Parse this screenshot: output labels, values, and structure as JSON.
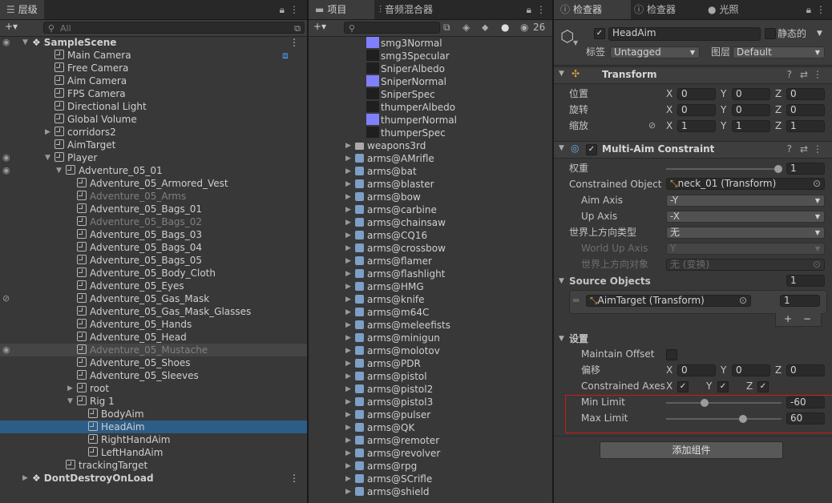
{
  "hierarchy": {
    "tab_label": "层级",
    "search_placeholder": "All",
    "add_label": "+▾",
    "rows": [
      {
        "label": "SampleScene",
        "indent": 0,
        "kind": "scene",
        "arrow": "down",
        "eye": true
      },
      {
        "label": "Main Camera",
        "indent": 2,
        "kind": "cube"
      },
      {
        "label": "Free Camera",
        "indent": 2,
        "kind": "cube"
      },
      {
        "label": "Aim Camera",
        "indent": 2,
        "kind": "cube"
      },
      {
        "label": "FPS Camera",
        "indent": 2,
        "kind": "cube"
      },
      {
        "label": "Directional Light",
        "indent": 2,
        "kind": "cube"
      },
      {
        "label": "Global Volume",
        "indent": 2,
        "kind": "cube"
      },
      {
        "label": "corridors2",
        "indent": 2,
        "kind": "cube",
        "arrow": "right"
      },
      {
        "label": "AimTarget",
        "indent": 2,
        "kind": "cube"
      },
      {
        "label": "Player",
        "indent": 2,
        "kind": "cube",
        "arrow": "down",
        "eye": true
      },
      {
        "label": "Adventure_05_01",
        "indent": 3,
        "kind": "cube",
        "arrow": "down",
        "eye": true
      },
      {
        "label": "Adventure_05_Armored_Vest",
        "indent": 4,
        "kind": "cube"
      },
      {
        "label": "Adventure_05_Arms",
        "indent": 4,
        "kind": "cube",
        "dim": true
      },
      {
        "label": "Adventure_05_Bags_01",
        "indent": 4,
        "kind": "cube"
      },
      {
        "label": "Adventure_05_Bags_02",
        "indent": 4,
        "kind": "cube",
        "dim": true
      },
      {
        "label": "Adventure_05_Bags_03",
        "indent": 4,
        "kind": "cube"
      },
      {
        "label": "Adventure_05_Bags_04",
        "indent": 4,
        "kind": "cube"
      },
      {
        "label": "Adventure_05_Bags_05",
        "indent": 4,
        "kind": "cube"
      },
      {
        "label": "Adventure_05_Body_Cloth",
        "indent": 4,
        "kind": "cube"
      },
      {
        "label": "Adventure_05_Eyes",
        "indent": 4,
        "kind": "cube"
      },
      {
        "label": "Adventure_05_Gas_Mask",
        "indent": 4,
        "kind": "cube",
        "eyeoff": true
      },
      {
        "label": "Adventure_05_Gas_Mask_Glasses",
        "indent": 4,
        "kind": "cube"
      },
      {
        "label": "Adventure_05_Hands",
        "indent": 4,
        "kind": "cube"
      },
      {
        "label": "Adventure_05_Head",
        "indent": 4,
        "kind": "cube"
      },
      {
        "label": "Adventure_05_Mustache",
        "indent": 4,
        "kind": "cube",
        "dim": true,
        "hl": true,
        "eye": true
      },
      {
        "label": "Adventure_05_Shoes",
        "indent": 4,
        "kind": "cube"
      },
      {
        "label": "Adventure_05_Sleeves",
        "indent": 4,
        "kind": "cube"
      },
      {
        "label": "root",
        "indent": 4,
        "kind": "cube",
        "arrow": "right"
      },
      {
        "label": "Rig 1",
        "indent": 4,
        "kind": "cube",
        "arrow": "down"
      },
      {
        "label": "BodyAim",
        "indent": 5,
        "kind": "cube"
      },
      {
        "label": "HeadAim",
        "indent": 5,
        "kind": "cube",
        "sel": true
      },
      {
        "label": "RightHandAim",
        "indent": 5,
        "kind": "cube"
      },
      {
        "label": "LeftHandAim",
        "indent": 5,
        "kind": "cube"
      },
      {
        "label": "trackingTarget",
        "indent": 3,
        "kind": "cube"
      },
      {
        "label": "DontDestroyOnLoad",
        "indent": 0,
        "kind": "scene",
        "arrow": "right"
      }
    ]
  },
  "project": {
    "tab_project": "项目",
    "tab_mixer": "音频混合器",
    "count": "26",
    "items": [
      {
        "label": "smg3Normal",
        "kind": "normal",
        "indent": 2
      },
      {
        "label": "smg3Specular",
        "kind": "dark",
        "indent": 2
      },
      {
        "label": "SniperAlbedo",
        "kind": "dark",
        "indent": 2
      },
      {
        "label": "SniperNormal",
        "kind": "normal",
        "indent": 2
      },
      {
        "label": "SniperSpec",
        "kind": "dark",
        "indent": 2
      },
      {
        "label": "thumperAlbedo",
        "kind": "dark",
        "indent": 2
      },
      {
        "label": "thumperNormal",
        "kind": "normal",
        "indent": 2
      },
      {
        "label": "thumperSpec",
        "kind": "dark",
        "indent": 2
      },
      {
        "label": "weapons3rd",
        "kind": "folder",
        "indent": 1
      },
      {
        "label": "arms@AMrifle",
        "kind": "prefab",
        "indent": 1
      },
      {
        "label": "arms@bat",
        "kind": "prefab",
        "indent": 1
      },
      {
        "label": "arms@blaster",
        "kind": "prefab",
        "indent": 1
      },
      {
        "label": "arms@bow",
        "kind": "prefab",
        "indent": 1
      },
      {
        "label": "arms@carbine",
        "kind": "prefab",
        "indent": 1
      },
      {
        "label": "arms@chainsaw",
        "kind": "prefab",
        "indent": 1
      },
      {
        "label": "arms@CQ16",
        "kind": "prefab",
        "indent": 1
      },
      {
        "label": "arms@crossbow",
        "kind": "prefab",
        "indent": 1
      },
      {
        "label": "arms@flamer",
        "kind": "prefab",
        "indent": 1
      },
      {
        "label": "arms@flashlight",
        "kind": "prefab",
        "indent": 1
      },
      {
        "label": "arms@HMG",
        "kind": "prefab",
        "indent": 1
      },
      {
        "label": "arms@knife",
        "kind": "prefab",
        "indent": 1
      },
      {
        "label": "arms@m64C",
        "kind": "prefab",
        "indent": 1
      },
      {
        "label": "arms@meleefists",
        "kind": "prefab",
        "indent": 1
      },
      {
        "label": "arms@minigun",
        "kind": "prefab",
        "indent": 1
      },
      {
        "label": "arms@molotov",
        "kind": "prefab",
        "indent": 1
      },
      {
        "label": "arms@PDR",
        "kind": "prefab",
        "indent": 1
      },
      {
        "label": "arms@pistol",
        "kind": "prefab",
        "indent": 1
      },
      {
        "label": "arms@pistol2",
        "kind": "prefab",
        "indent": 1
      },
      {
        "label": "arms@pistol3",
        "kind": "prefab",
        "indent": 1
      },
      {
        "label": "arms@pulser",
        "kind": "prefab",
        "indent": 1
      },
      {
        "label": "arms@QK",
        "kind": "prefab",
        "indent": 1
      },
      {
        "label": "arms@remoter",
        "kind": "prefab",
        "indent": 1
      },
      {
        "label": "arms@revolver",
        "kind": "prefab",
        "indent": 1
      },
      {
        "label": "arms@rpg",
        "kind": "prefab",
        "indent": 1
      },
      {
        "label": "arms@SCrifle",
        "kind": "prefab",
        "indent": 1
      },
      {
        "label": "arms@shield",
        "kind": "prefab",
        "indent": 1
      }
    ]
  },
  "inspector": {
    "tab1": "检查器",
    "tab2": "检查器",
    "tab3": "光照",
    "object_name": "HeadAim",
    "static_label": "静态的",
    "tag_label": "标签",
    "tag_value": "Untagged",
    "layer_label": "图层",
    "layer_value": "Default",
    "transform": {
      "title": "Transform",
      "position_label": "位置",
      "rotation_label": "旋转",
      "scale_label": "缩放",
      "position": {
        "x": "0",
        "y": "0",
        "z": "0"
      },
      "rotation": {
        "x": "0",
        "y": "0",
        "z": "0"
      },
      "scale": {
        "x": "1",
        "y": "1",
        "z": "1"
      }
    },
    "mac": {
      "title": "Multi-Aim Constraint",
      "weight_label": "权重",
      "weight_value": "1",
      "weight_fraction": 1.0,
      "constrained_label": "Constrained Object",
      "constrained_value": "neck_01 (Transform)",
      "aim_axis_label": "Aim Axis",
      "aim_axis_value": "-Y",
      "up_axis_label": "Up Axis",
      "up_axis_value": "-X",
      "world_up_type_label": "世界上方向类型",
      "world_up_type_value": "无",
      "world_up_axis_label": "World Up Axis",
      "world_up_axis_value": "Y",
      "world_up_object_label": "世界上方向对象",
      "world_up_object_value": "无 (变换)",
      "source_label": "Source Objects",
      "source_count": "1",
      "source_item": "AimTarget (Transform)",
      "source_weight": "1",
      "settings_label": "设置",
      "maintain_offset_label": "Maintain Offset",
      "offset_label": "偏移",
      "offset": {
        "x": "0",
        "y": "0",
        "z": "0"
      },
      "constrained_axes_label": "Constrained Axes",
      "min_limit_label": "Min Limit",
      "min_limit_value": "-60",
      "min_limit_fraction": 0.33,
      "max_limit_label": "Max Limit",
      "max_limit_value": "60",
      "max_limit_fraction": 0.67
    },
    "add_component": "添加组件"
  },
  "axis_letters": {
    "x": "X",
    "y": "Y",
    "z": "Z"
  },
  "colors": {
    "selection": "#2c5d87",
    "highlight_box": "#d01818",
    "normal_map": "#8080ff"
  }
}
